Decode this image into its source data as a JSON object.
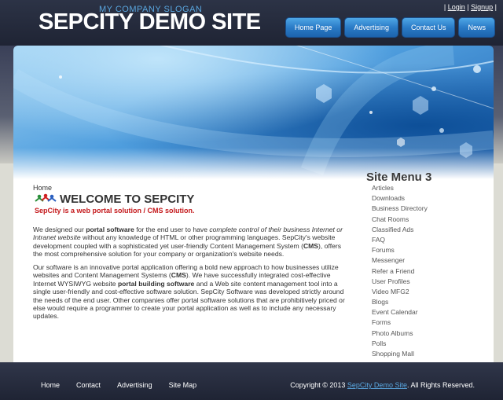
{
  "header": {
    "slogan": "MY COMPANY SLOGAN",
    "site_title": "SEPCITY DEMO SITE",
    "user_links": {
      "login": "Login",
      "signup": "Signup",
      "separator": "|"
    },
    "nav": [
      "Home Page",
      "Advertising",
      "Contact Us",
      "News"
    ]
  },
  "main": {
    "breadcrumb": "Home",
    "welcome_title": "WELCOME TO SEPCITY",
    "welcome_subtitle": "SepCity is a web portal solution / CMS solution.",
    "paragraph1": [
      {
        "t": "We designed our "
      },
      {
        "t": "portal software",
        "b": true
      },
      {
        "t": " for the end user to have "
      },
      {
        "t": "complete control of their business Internet or Intranet website",
        "i": true
      },
      {
        "t": " without any knowledge of HTML or other programming languages. SepCity's website development coupled with a sophisticated yet user-friendly Content Management System ("
      },
      {
        "t": "CMS",
        "b": true
      },
      {
        "t": "), offers the most comprehensive solution for your company or organization's website needs."
      }
    ],
    "paragraph2": [
      {
        "t": "Our software is an innovative portal application offering a bold new approach to how businesses utilize websites and Content Management Systems ("
      },
      {
        "t": "CMS",
        "b": true
      },
      {
        "t": "). We have successfully integrated cost-effective Internet WYSIWYG website "
      },
      {
        "t": "portal building software",
        "b": true
      },
      {
        "t": " and a Web site content management tool into a single user-friendly and cost-effective software solution. SepCity Software was developed strictly around the needs of the end user. Other companies offer portal software solutions that are prohibitively priced or else would require a programmer to create your portal application as well as to include any necessary updates."
      }
    ]
  },
  "sidebar": {
    "title": "Site Menu 3",
    "items": [
      "Articles",
      "Downloads",
      "Business Directory",
      "Chat Rooms",
      "Classified Ads",
      "FAQ",
      "Forums",
      "Messenger",
      "Refer a Friend",
      "User Profiles",
      "Video MFG2",
      "Blogs",
      "Event Calendar",
      "Forms",
      "Photo Albums",
      "Polls",
      "Shopping Mall"
    ]
  },
  "footer": {
    "links": [
      "Home",
      "Contact",
      "Advertising",
      "Site Map"
    ],
    "copyright_prefix": "Copyright © 2013 ",
    "copyright_link": "SepCity Demo Site",
    "copyright_suffix": ". All Rights Reserved."
  },
  "colors": {
    "header_bg": "#262b3d",
    "nav_button": "#2a7bc6",
    "slogan": "#5aa7e0",
    "welcome_subtitle": "#c4181b"
  }
}
